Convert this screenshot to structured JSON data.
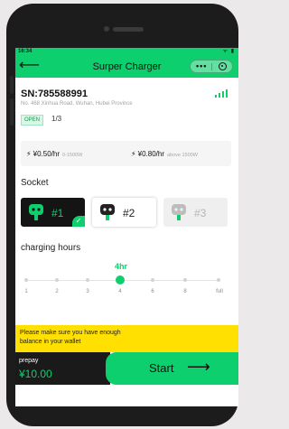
{
  "status_bar": {
    "time": "16:34",
    "icons": "ᯤ ▮"
  },
  "app_bar": {
    "back_glyph": "⟵",
    "title": "Surper Charger",
    "more_glyph": "•••"
  },
  "station": {
    "sn": "SN:785588991",
    "address": "No. 468 Xinhua Road, Wuhan, Hubei Province",
    "status": "OPEN",
    "count": "1/3"
  },
  "prices": [
    {
      "price": "¥0.50/hr",
      "range": "0-1500W"
    },
    {
      "price": "¥0.80/hr",
      "range": "above 1500W"
    }
  ],
  "socket": {
    "title": "Socket",
    "items": [
      {
        "label": "#1",
        "state": "selected"
      },
      {
        "label": "#2",
        "state": "available"
      },
      {
        "label": "#3",
        "state": "disabled"
      }
    ]
  },
  "hours": {
    "title": "charging hours",
    "selected": "4hr",
    "selected_index": 3,
    "ticks": [
      "1",
      "2",
      "3",
      "4",
      "6",
      "8",
      "full"
    ]
  },
  "warning": {
    "line1": "Please make sure you have enough",
    "line2": "balance in your wallet"
  },
  "footer": {
    "prepay_label": "prepay",
    "amount": "¥10.00",
    "start_label": "Start",
    "start_arrow": "⟶"
  },
  "colors": {
    "accent": "#0ecf6e",
    "warning": "#ffe000",
    "dark": "#1a1a1a"
  }
}
